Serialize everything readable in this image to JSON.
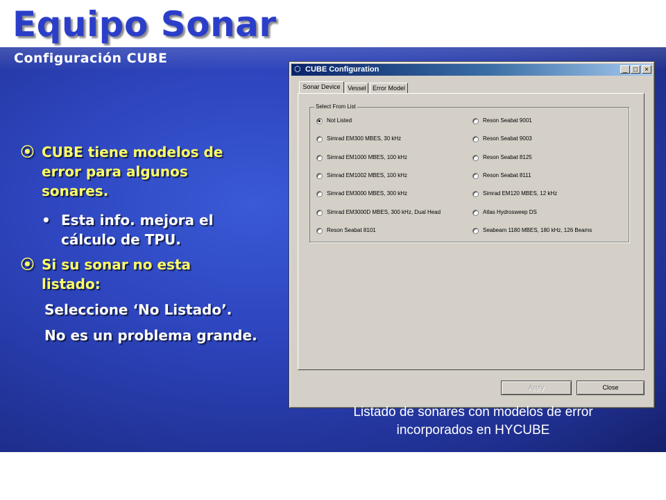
{
  "slide": {
    "title": "Equipo Sonar",
    "subtitle": "Configuración CUBE",
    "bullet_symbol": "⦿",
    "sub_bullet_symbol": "•",
    "bullet1": "CUBE tiene modelos de error para algunos sonares.",
    "sub_bullet": "Esta info. mejora el cálculo de TPU.",
    "bullet2": "Si su sonar no esta listado:",
    "line1": "Seleccione ‘No Listado’.",
    "line2": "No es un problema grande.",
    "caption_line1": "Listado de sonares con modelos de error",
    "caption_line2": "incorporados en HYCUBE"
  },
  "window": {
    "title": "CUBE Configuration",
    "controls": {
      "minimize": "_",
      "maximize": "□",
      "close": "×"
    },
    "tabs": [
      "Sonar Device",
      "Vessel",
      "Error Model"
    ],
    "active_tab": "Sonar Device",
    "group_label": "Select From List",
    "radios_left": [
      "Not Listed",
      "Simrad EM300 MBES, 30 kHz",
      "Simrad EM1000 MBES, 100 kHz",
      "Simrad EM1002 MBES, 100 kHz",
      "Simrad EM3000 MBES, 300 kHz",
      "Simrad EM3000D MBES, 300 kHz, Dual Head",
      "Reson Seabat 8101"
    ],
    "radios_right": [
      "Reson Seabat 9001",
      "Reson Seabat 9003",
      "Reson Seabat 8125",
      "Reson Seabat 8111",
      "Simrad EM120 MBES, 12 kHz",
      "Atlas Hydrosweep DS",
      "Seabeam 1180 MBES, 180 kHz, 126 Beams"
    ],
    "selected": "Not Listed",
    "apply_label": "Apply",
    "close_label": "Close"
  },
  "colors": {
    "title_blue": "#2b3ec9",
    "bullet_yellow": "#ffff66",
    "slide_blue": "#2e46c0",
    "win_gray": "#d4d0c8",
    "titlebar_navy": "#0a246a"
  }
}
